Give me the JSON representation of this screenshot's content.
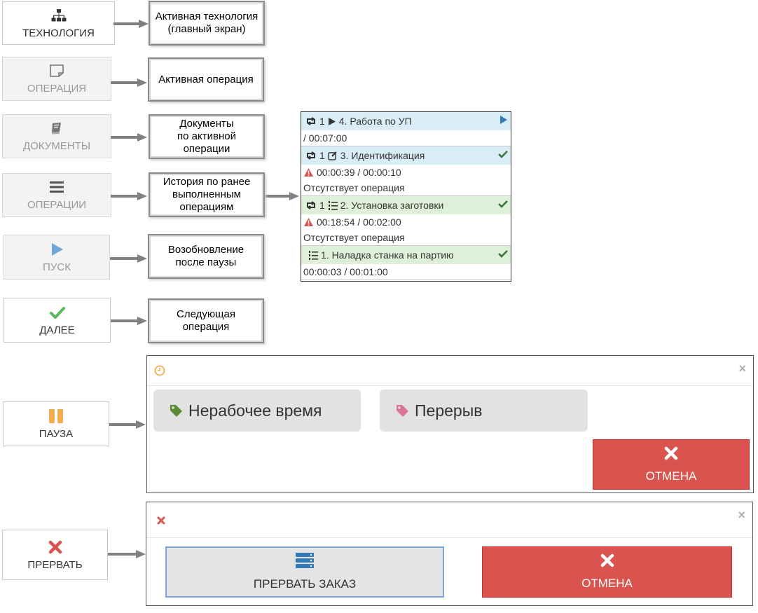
{
  "buttons": {
    "technology": "ТЕХНОЛОГИЯ",
    "operation": "ОПЕРАЦИЯ",
    "documents": "ДОКУМЕНТЫ",
    "operations": "ОПЕРАЦИИ",
    "start": "ПУСК",
    "next": "ДАЛЕЕ",
    "pause": "ПАУЗА",
    "abort": "ПРЕРВАТЬ"
  },
  "notes": {
    "technology": [
      "Активная технология",
      "(главный экран)"
    ],
    "operation": [
      "Активная операция"
    ],
    "documents": [
      "Документы",
      "по активной",
      "операции"
    ],
    "history": [
      "История по ранее",
      "выполненным",
      "операциям"
    ],
    "resume": [
      "Возобновление",
      "после паузы"
    ],
    "next": [
      "Следующая",
      "операция"
    ]
  },
  "history": {
    "items": [
      {
        "count": "1",
        "title": "4. Работа по УП",
        "line1": "/ 00:07:00",
        "line2": ""
      },
      {
        "count": "1",
        "title": "3. Идентификация",
        "line1": "00:00:39 / 00:00:10",
        "line2": "Отсутствует операция"
      },
      {
        "count": "1",
        "title": "2. Установка заготовки",
        "line1": "00:18:54 / 00:02:00",
        "line2": "Отсутствует операция"
      },
      {
        "count": "",
        "title": "1. Наладка станка на партию",
        "line1": "00:00:03 / 00:01:00",
        "line2": ""
      }
    ]
  },
  "pause_dialog": {
    "option1": "Нерабочее время",
    "option2": "Перерыв",
    "cancel": "ОТМЕНА",
    "close": "×"
  },
  "abort_dialog": {
    "abort_order": "ПРЕРВАТЬ ЗАКАЗ",
    "cancel": "ОТМЕНА",
    "close": "×"
  },
  "colors": {
    "accent_blue": "#337ab7",
    "success_green": "#5cb85c",
    "danger_red": "#d9534f",
    "warning_orange": "#f0ad4e"
  }
}
